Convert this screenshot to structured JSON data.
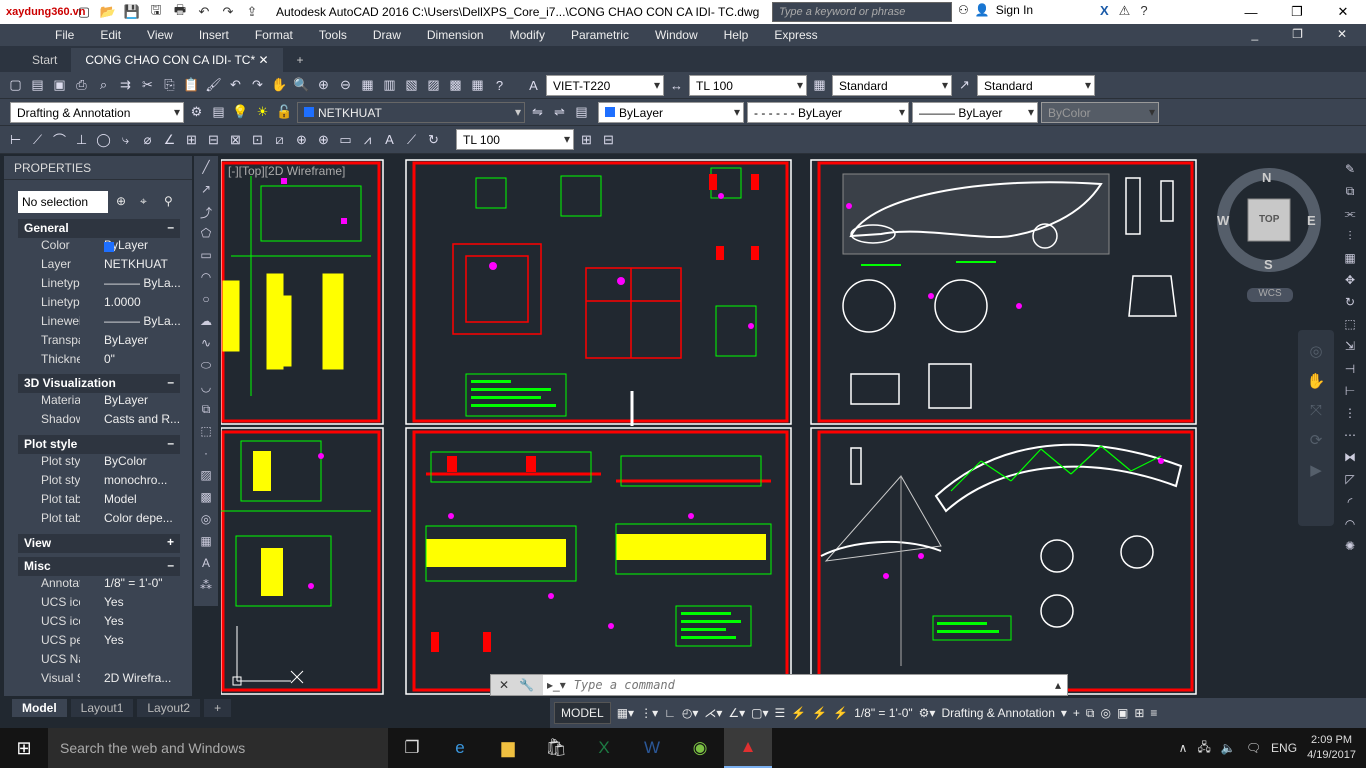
{
  "titlebar": {
    "logo_text": "xaydung360.vn",
    "app_title": "Autodesk AutoCAD 2016    C:\\Users\\DellXPS_Core_i7...\\CONG CHAO CON CA IDI- TC.dwg",
    "search_placeholder": "Type a keyword or phrase",
    "signin": "Sign In"
  },
  "menu": [
    "File",
    "Edit",
    "View",
    "Insert",
    "Format",
    "Tools",
    "Draw",
    "Dimension",
    "Modify",
    "Parametric",
    "Window",
    "Help",
    "Express"
  ],
  "tabs": {
    "start": "Start",
    "active": "CONG CHAO CON CA IDI- TC*",
    "add": "+"
  },
  "toolbar1": {
    "textstyle": "VIET-T220",
    "dimstyle": "TL 100",
    "tablestyle": "Standard",
    "mleaderstyle": "Standard"
  },
  "toolbar2": {
    "workspace": "Drafting & Annotation",
    "layer": "NETKHUAT",
    "color": "ByLayer",
    "linetype": "ByLayer",
    "lineweight": "ByLayer",
    "plotstyle": "ByColor"
  },
  "toolbar3": {
    "dimstyle": "TL 100"
  },
  "properties": {
    "title": "PROPERTIES",
    "selection": "No selection",
    "sections": {
      "general": "General",
      "visualization": "3D Visualization",
      "plot": "Plot style",
      "view": "View",
      "misc": "Misc"
    },
    "general_rows": [
      {
        "k": "Color",
        "v": "ByLayer"
      },
      {
        "k": "Layer",
        "v": "NETKHUAT"
      },
      {
        "k": "Linetype",
        "v": "——— ByLa..."
      },
      {
        "k": "Linetype...",
        "v": "1.0000"
      },
      {
        "k": "Linewei...",
        "v": "——— ByLa..."
      },
      {
        "k": "Transpar...",
        "v": "ByLayer"
      },
      {
        "k": "Thickness",
        "v": "0\""
      }
    ],
    "vis_rows": [
      {
        "k": "Material",
        "v": "ByLayer"
      },
      {
        "k": "Shadow...",
        "v": "Casts and R..."
      }
    ],
    "plot_rows": [
      {
        "k": "Plot style",
        "v": "ByColor"
      },
      {
        "k": "Plot styl...",
        "v": "monochro..."
      },
      {
        "k": "Plot tabl...",
        "v": "Model"
      },
      {
        "k": "Plot tabl...",
        "v": "Color depe..."
      }
    ],
    "misc_rows": [
      {
        "k": "Annotati...",
        "v": "1/8\" = 1'-0\""
      },
      {
        "k": "UCS ico...",
        "v": "Yes"
      },
      {
        "k": "UCS ico...",
        "v": "Yes"
      },
      {
        "k": "UCS per...",
        "v": "Yes"
      },
      {
        "k": "UCS Na...",
        "v": ""
      },
      {
        "k": "Visual St...",
        "v": "2D Wirefra..."
      }
    ]
  },
  "viewport_label": "[-][Top][2D Wireframe]",
  "viewcube": {
    "n": "N",
    "s": "S",
    "e": "E",
    "w": "W",
    "face": "TOP",
    "wcs": "WCS"
  },
  "command": {
    "placeholder": "Type a command"
  },
  "layouts": [
    "Model",
    "Layout1",
    "Layout2"
  ],
  "status": {
    "model": "MODEL",
    "scale": "1/8\" = 1'-0\"",
    "workspace": "Drafting & Annotation"
  },
  "taskbar": {
    "search": "Search the web and Windows",
    "lang": "ENG",
    "time": "2:09 PM",
    "date": "4/19/2017"
  },
  "colors": {
    "accent": "#ff0000",
    "ui_dark": "#3b4452",
    "cad_bg": "#212830",
    "green": "#00ff00",
    "yellow": "#ffff00",
    "magenta": "#ff00ff"
  }
}
